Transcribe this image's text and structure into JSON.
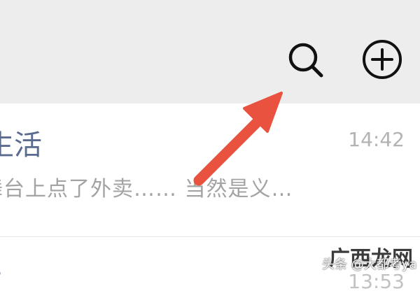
{
  "header": {
    "actions": [
      {
        "icon": "search-icon"
      },
      {
        "icon": "plus-circle-icon"
      }
    ]
  },
  "chats": [
    {
      "name": "生活",
      "time": "14:42",
      "preview": "舞台上点了外卖…… 当然是义…"
    },
    {
      "name": "-",
      "time": "13:53"
    }
  ],
  "annotation": {
    "type": "arrow",
    "color": "#e8523f",
    "points_to": "search-button"
  },
  "watermark": {
    "logo": "广西龙网",
    "text": "头条 @大都考ya"
  },
  "colors": {
    "header_bg": "#ededed",
    "name": "#5b6b8f",
    "time": "#b3b3b3",
    "preview": "#a3a3a3",
    "arrow": "#e8523f"
  }
}
